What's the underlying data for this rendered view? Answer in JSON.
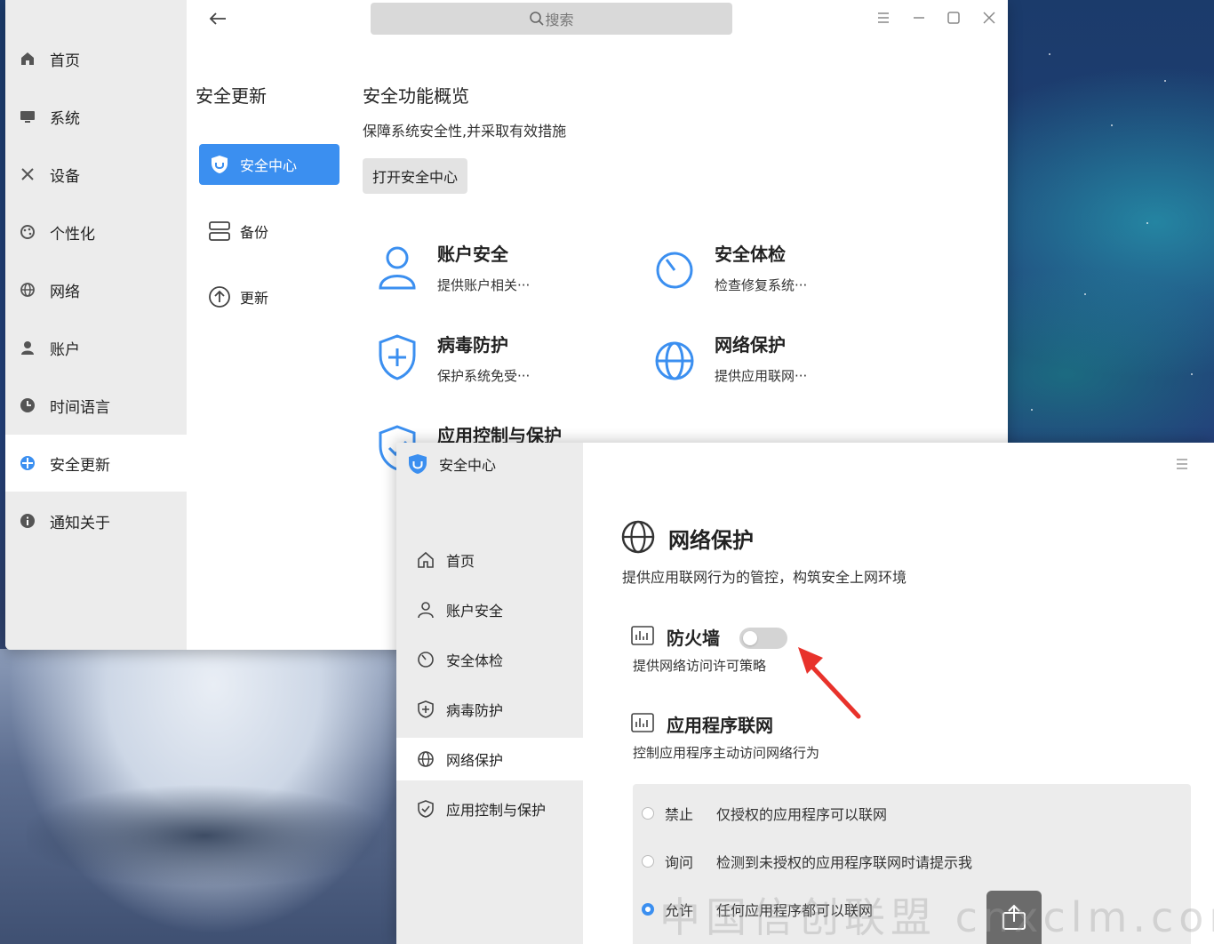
{
  "settings": {
    "nav": [
      {
        "label": "首页",
        "icon": "home-icon"
      },
      {
        "label": "系统",
        "icon": "monitor-icon"
      },
      {
        "label": "设备",
        "icon": "tools-icon"
      },
      {
        "label": "个性化",
        "icon": "palette-icon"
      },
      {
        "label": "网络",
        "icon": "network-icon"
      },
      {
        "label": "账户",
        "icon": "user-icon"
      },
      {
        "label": "时间语言",
        "icon": "clock-icon"
      },
      {
        "label": "安全更新",
        "icon": "shield-icon",
        "active": true
      },
      {
        "label": "通知关于",
        "icon": "info-icon"
      }
    ],
    "subnav": {
      "title": "安全更新",
      "items": [
        {
          "label": "安全中心",
          "icon": "shield-icon",
          "active": true
        },
        {
          "label": "备份",
          "icon": "storage-icon"
        },
        {
          "label": "更新",
          "icon": "upload-icon"
        }
      ]
    },
    "search": {
      "placeholder": "搜索"
    },
    "content": {
      "title": "安全功能概览",
      "desc": "保障系统安全性,并采取有效措施",
      "open_button": "打开安全中心",
      "features": [
        {
          "title": "账户安全",
          "desc": "提供账户相关···",
          "icon": "user-icon"
        },
        {
          "title": "安全体检",
          "desc": "检查修复系统···",
          "icon": "gauge-icon"
        },
        {
          "title": "病毒防护",
          "desc": "保护系统免受···",
          "icon": "shield-plus-icon"
        },
        {
          "title": "网络保护",
          "desc": "提供应用联网···",
          "icon": "globe-icon"
        },
        {
          "title": "应用控制与保护",
          "desc": "",
          "icon": "shield-check-icon"
        }
      ]
    }
  },
  "security_center": {
    "title": "安全中心",
    "nav": [
      {
        "label": "首页",
        "icon": "home-icon"
      },
      {
        "label": "账户安全",
        "icon": "user-icon"
      },
      {
        "label": "安全体检",
        "icon": "gauge-icon"
      },
      {
        "label": "病毒防护",
        "icon": "shield-plus-icon"
      },
      {
        "label": "网络保护",
        "icon": "globe-icon",
        "active": true
      },
      {
        "label": "应用控制与保护",
        "icon": "shield-check-icon"
      }
    ],
    "page": {
      "title": "网络保护",
      "desc": "提供应用联网行为的管控，构筑安全上网环境",
      "firewall": {
        "title": "防火墙",
        "desc": "提供网络访问许可策略",
        "enabled": false
      },
      "app_network": {
        "title": "应用程序联网",
        "desc": "控制应用程序主动访问网络行为",
        "options": [
          {
            "name": "禁止",
            "desc": "仅授权的应用程序可以联网",
            "selected": false
          },
          {
            "name": "询问",
            "desc": "检测到未授权的应用程序联网时请提示我",
            "selected": false
          },
          {
            "name": "允许",
            "desc": "任何应用程序都可以联网",
            "selected": true
          }
        ]
      }
    }
  },
  "watermark": "中国信创联盟 cnxclm.com",
  "colors": {
    "accent": "#3b8ff0",
    "annotation_arrow": "#e8322b"
  }
}
